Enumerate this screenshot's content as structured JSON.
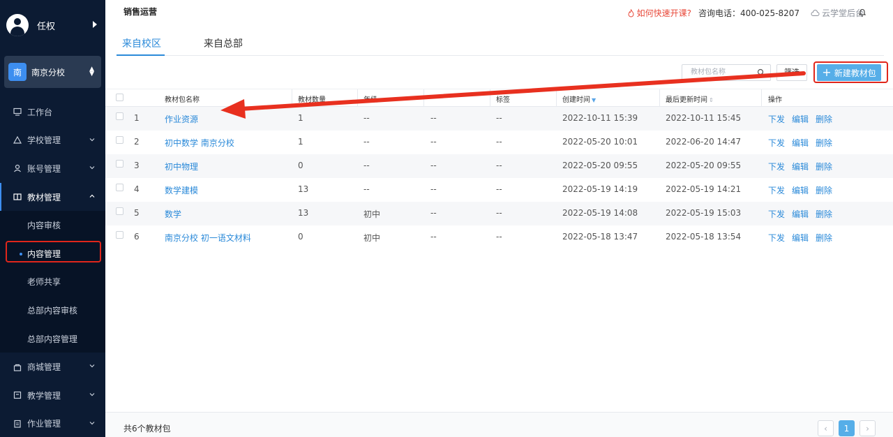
{
  "sidebar": {
    "user_name": "任权",
    "school_badge": "南",
    "school_name": "南京分校",
    "menu": [
      {
        "label": "工作台"
      },
      {
        "label": "学校管理"
      },
      {
        "label": "账号管理"
      },
      {
        "label": "教材管理"
      }
    ],
    "submenu": [
      {
        "label": "内容审核"
      },
      {
        "label": "内容管理"
      },
      {
        "label": "老师共享"
      },
      {
        "label": "总部内容审核"
      },
      {
        "label": "总部内容管理"
      }
    ],
    "menu_bottom": [
      {
        "label": "商城管理"
      },
      {
        "label": "教学管理"
      },
      {
        "label": "作业管理"
      }
    ]
  },
  "header": {
    "page_name": "销售运营",
    "help_link": "如何快速开课?",
    "phone": "咨询电话：400-025-8207",
    "backend_link": "云学堂后台"
  },
  "tabs": [
    {
      "label": "来自校区"
    },
    {
      "label": "来自总部"
    }
  ],
  "toolbar": {
    "search_placeholder": "教材包名称",
    "filter_label": "筛选",
    "new_label": "新建教材包"
  },
  "table": {
    "columns": [
      "教材包名称",
      "教材数量",
      "年级",
      "",
      "标签",
      "创建时间",
      "最后更新时间",
      "操作"
    ],
    "rows": [
      {
        "no": "1",
        "name": "作业资源",
        "count": "1",
        "grade": "--",
        "col4": "--",
        "tag": "--",
        "created": "2022-10-11 15:39",
        "updated": "2022-10-11 15:45"
      },
      {
        "no": "2",
        "name": "初中数学 南京分校",
        "count": "1",
        "grade": "--",
        "col4": "--",
        "tag": "--",
        "created": "2022-05-20 10:01",
        "updated": "2022-06-20 14:47"
      },
      {
        "no": "3",
        "name": "初中物理",
        "count": "0",
        "grade": "--",
        "col4": "--",
        "tag": "--",
        "created": "2022-05-20 09:55",
        "updated": "2022-05-20 09:55"
      },
      {
        "no": "4",
        "name": "数学建模",
        "count": "13",
        "grade": "--",
        "col4": "--",
        "tag": "--",
        "created": "2022-05-19 14:19",
        "updated": "2022-05-19 14:21"
      },
      {
        "no": "5",
        "name": "数学",
        "count": "13",
        "grade": "初中",
        "col4": "--",
        "tag": "--",
        "created": "2022-05-19 14:08",
        "updated": "2022-05-19 15:03"
      },
      {
        "no": "6",
        "name": "南京分校 初一语文材料",
        "count": "0",
        "grade": "初中",
        "col4": "--",
        "tag": "--",
        "created": "2022-05-18 13:47",
        "updated": "2022-05-18 13:54"
      }
    ],
    "actions": [
      "下发",
      "编辑",
      "删除"
    ]
  },
  "footer": {
    "total": "共6个教材包",
    "current_page": "1"
  },
  "colors": {
    "sidebar_bg": "#0c1b33",
    "accent": "#2b8ad9",
    "primary_button": "#56aee8",
    "annotation": "#e0261b"
  }
}
